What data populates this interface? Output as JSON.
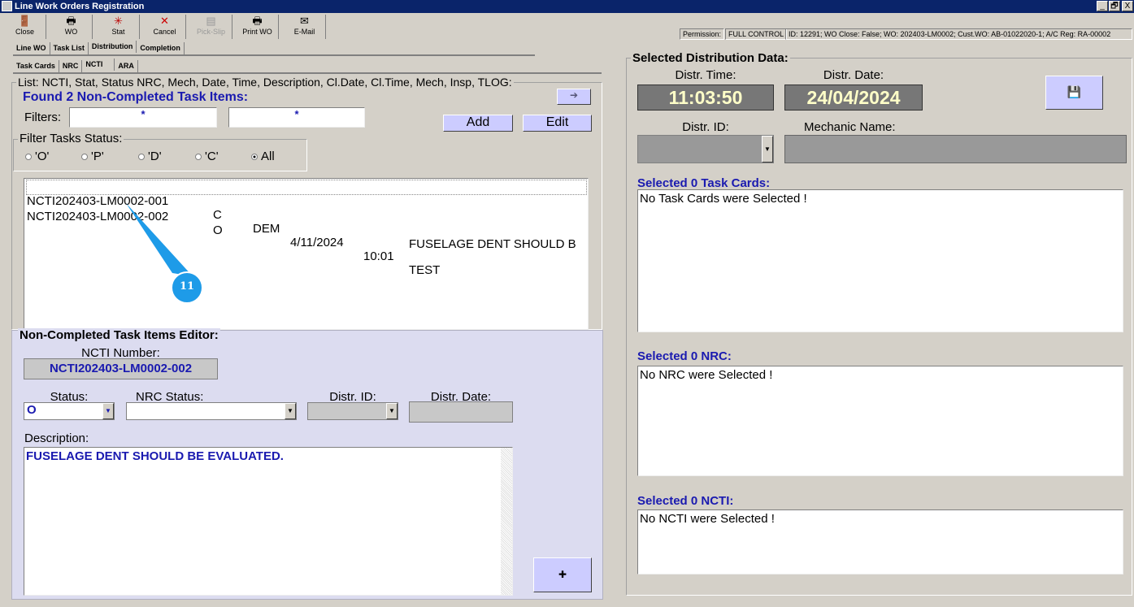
{
  "window": {
    "title": "Line Work Orders Registration",
    "controls": [
      "_",
      "🗗",
      "X"
    ]
  },
  "toolbar": [
    {
      "label": "Close",
      "icon": "door-icon",
      "glyph": "🚪"
    },
    {
      "label": "WO",
      "icon": "printer-doc-icon",
      "glyph": "🖶"
    },
    {
      "label": "Stat",
      "icon": "stat-icon",
      "glyph": "✳"
    },
    {
      "label": "Cancel",
      "icon": "x-icon",
      "glyph": "✕"
    },
    {
      "label": "Pick-Slip",
      "icon": "pick-slip-icon",
      "glyph": "▤"
    },
    {
      "label": "Print WO",
      "icon": "printer-icon",
      "glyph": "🖶"
    },
    {
      "label": "E-Mail",
      "icon": "mail-icon",
      "glyph": "✉"
    }
  ],
  "status": {
    "permission_label": "Permission:",
    "permission_value": "FULL CONTROL",
    "info": "ID: 12291; WO Close: False; WO: 202403-LM0002; Cust.WO: AB-01022020-1; A/C Reg: RA-00002"
  },
  "tabs": [
    "Line WO",
    "Task List",
    "Distribution",
    "Completion"
  ],
  "subtabs": [
    "Task Cards",
    "NRC",
    "NCTI",
    "ARA"
  ],
  "list": {
    "legend": "List: NCTI, Stat, Status NRC, Mech, Date, Time, Description, Cl.Date, Cl.Time, Mech, Insp, TLOG:",
    "found": "Found 2 Non-Completed Task Items:",
    "filters_label": "Filters:",
    "filter1": "*",
    "filter2": "*",
    "add": "Add",
    "edit": "Edit",
    "status_legend": "Filter Tasks Status:",
    "radios": [
      "'O'",
      "'P'",
      "'D'",
      "'C'",
      "All"
    ],
    "rows": [
      {
        "id": "NCTI202403-LM0002-001",
        "stat": "C",
        "mech": "DEM",
        "date": "4/11/2024",
        "time": "10:01",
        "desc": "TEST"
      },
      {
        "id": "NCTI202403-LM0002-002",
        "stat": "O",
        "mech": "",
        "date": "",
        "time": "",
        "desc": "FUSELAGE DENT SHOULD B"
      }
    ]
  },
  "annotation": "11",
  "editor": {
    "legend": "Non-Completed Task Items Editor:",
    "number_label": "NCTI Number:",
    "number": "NCTI202403-LM0002-002",
    "status_label": "Status:",
    "status": "O",
    "nrc_label": "NRC Status:",
    "distr_id_label": "Distr. ID:",
    "distr_date_label": "Distr. Date:",
    "desc_label": "Description:",
    "desc": "FUSELAGE DENT SHOULD BE EVALUATED."
  },
  "dist": {
    "legend": "Selected Distribution Data:",
    "time_label": "Distr. Time:",
    "time": "11:03:50",
    "date_label": "Distr. Date:",
    "date": "24/04/2024",
    "id_label": "Distr. ID:",
    "mech_label": "Mechanic Name:",
    "tc_label": "Selected 0 Task Cards:",
    "tc_text": "No Task Cards were Selected !",
    "nrc_label": "Selected 0 NRC:",
    "nrc_text": "No NRC were Selected !",
    "ncti_label": "Selected 0 NCTI:",
    "ncti_text": "No NCTI were Selected !"
  }
}
